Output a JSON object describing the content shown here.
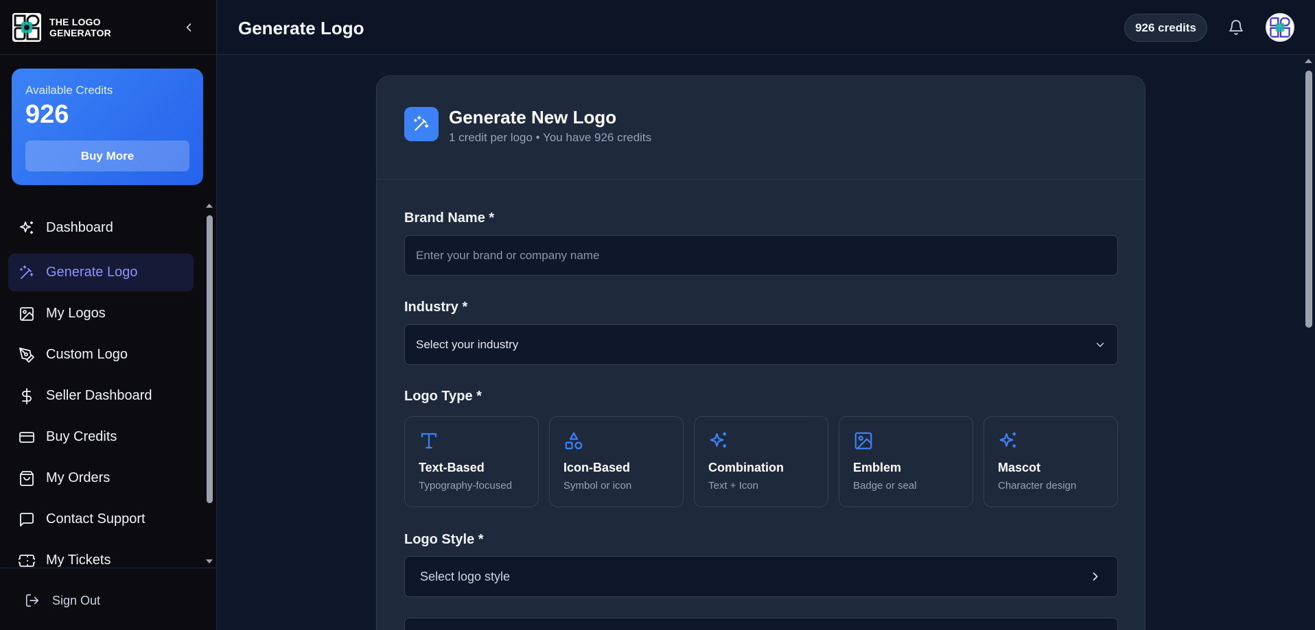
{
  "brand": {
    "name_line1": "THE LOGO",
    "name_line2": "GENERATOR"
  },
  "sidebar": {
    "credits_label": "Available Credits",
    "credits_value": "926",
    "buy_more_label": "Buy More",
    "items": [
      {
        "label": "Dashboard",
        "icon": "sparkles-icon"
      },
      {
        "label": "Generate Logo",
        "icon": "magic-wand-icon",
        "active": true
      },
      {
        "label": "My Logos",
        "icon": "image-icon"
      },
      {
        "label": "Custom Logo",
        "icon": "pen-tool-icon"
      },
      {
        "label": "Seller Dashboard",
        "icon": "dollar-icon"
      },
      {
        "label": "Buy Credits",
        "icon": "credit-card-icon"
      },
      {
        "label": "My Orders",
        "icon": "shopping-bag-icon"
      },
      {
        "label": "Contact Support",
        "icon": "message-square-icon"
      },
      {
        "label": "My Tickets",
        "icon": "ticket-icon"
      }
    ],
    "sign_out_label": "Sign Out"
  },
  "header": {
    "title": "Generate Logo",
    "credits_pill": "926 credits"
  },
  "form": {
    "title": "Generate New Logo",
    "subtitle": "1 credit per logo • You have 926 credits",
    "brand_name_label": "Brand Name *",
    "brand_name_placeholder": "Enter your brand or company name",
    "industry_label": "Industry *",
    "industry_value": "Select your industry",
    "logo_type_label": "Logo Type *",
    "logo_types": [
      {
        "name": "Text-Based",
        "desc": "Typography-focused",
        "icon": "type-icon"
      },
      {
        "name": "Icon-Based",
        "desc": "Symbol or icon",
        "icon": "shapes-icon"
      },
      {
        "name": "Combination",
        "desc": "Text + Icon",
        "icon": "sparkles-icon"
      },
      {
        "name": "Emblem",
        "desc": "Badge or seal",
        "icon": "image-icon"
      },
      {
        "name": "Mascot",
        "desc": "Character design",
        "icon": "sparkles-icon"
      }
    ],
    "logo_style_label": "Logo Style *",
    "logo_style_value": "Select logo style"
  },
  "colors": {
    "accent": "#3b82f6",
    "active_nav_text": "#8b93ff"
  }
}
